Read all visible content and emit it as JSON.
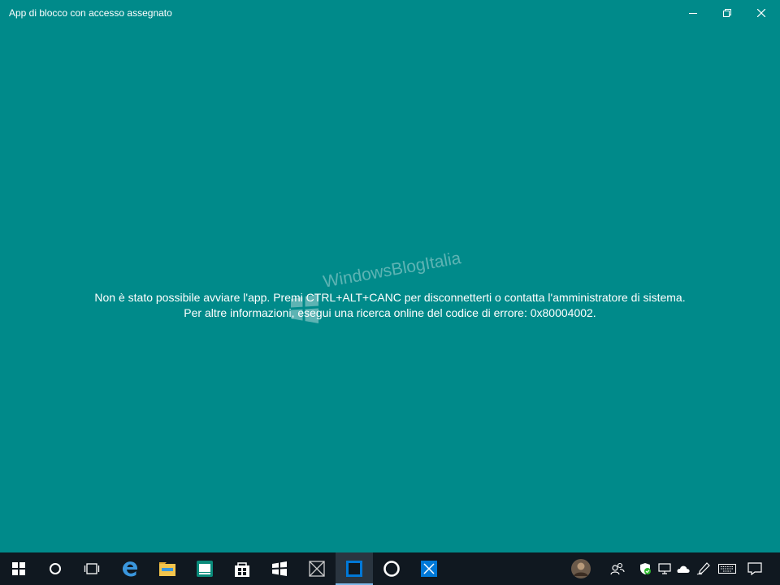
{
  "window": {
    "title": "App di blocco con accesso assegnato",
    "controls": [
      "minimize-icon",
      "restore-icon",
      "close-icon"
    ]
  },
  "message": {
    "line1": "Non è stato possibile avviare l'app. Premi CTRL+ALT+CANC per disconnetterti o contatta l'amministratore di sistema.",
    "line2": "Per altre informazioni, esegui una ricerca online del codice di errore: 0x80004002."
  },
  "watermark": {
    "text": "WindowsBlogItalia"
  },
  "colors": {
    "background": "#008a8a",
    "taskbar": "#101820",
    "accent": "#0078d7"
  },
  "taskbar": {
    "items": [
      "windows-start-icon",
      "cortana-search-icon",
      "task-view-icon",
      "edge-icon",
      "file-explorer-icon",
      "app-icon",
      "store-icon",
      "app-icon",
      "placeholder-app-icon",
      "assigned-access-app-icon",
      "cortana-icon",
      "app-icon"
    ],
    "active_item": "assigned-access-app-icon",
    "tray": [
      "user-avatar",
      "people-icon",
      "windows-defender-icon",
      "network-icon",
      "onedrive-icon",
      "pen-icon",
      "keyboard-icon",
      "notification-icon"
    ]
  }
}
